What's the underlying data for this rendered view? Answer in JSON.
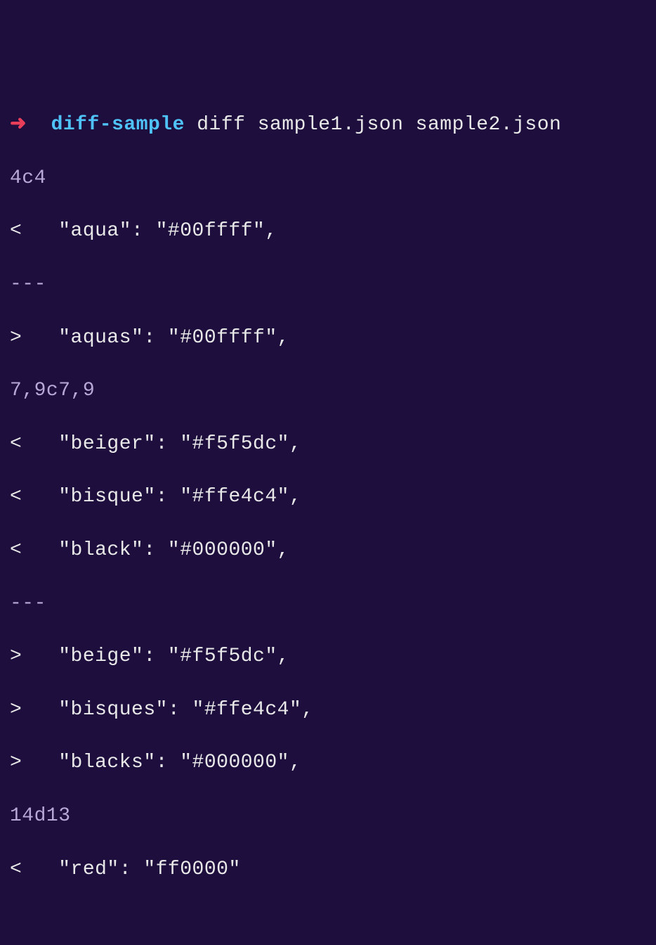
{
  "prompt": {
    "arrow": "➜",
    "directory": "diff-sample",
    "command": "diff sample1.json sample2.json"
  },
  "output": {
    "lines": [
      "4c4",
      "<   \"aqua\": \"#00ffff\",",
      "---",
      ">   \"aquas\": \"#00ffff\",",
      "7,9c7,9",
      "<   \"beiger\": \"#f5f5dc\",",
      "<   \"bisque\": \"#ffe4c4\",",
      "<   \"black\": \"#000000\",",
      "---",
      ">   \"beige\": \"#f5f5dc\",",
      ">   \"bisques\": \"#ffe4c4\",",
      ">   \"blacks\": \"#000000\",",
      "14d13",
      "<   \"red\": \"ff0000\""
    ]
  }
}
